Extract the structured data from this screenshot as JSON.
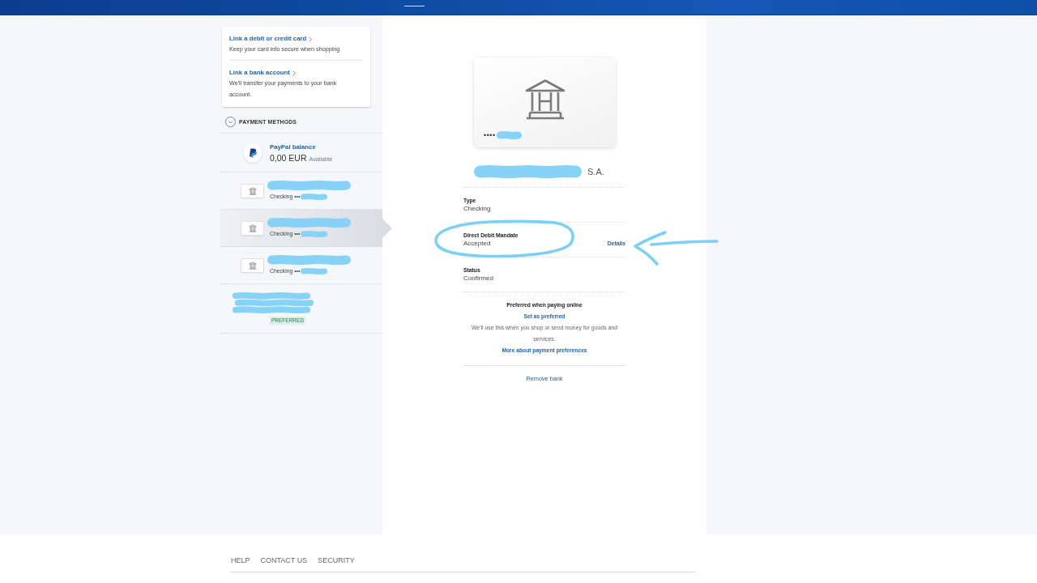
{
  "link_card": {
    "items": [
      {
        "title": "Link a debit or credit card",
        "text": "Keep your card info secure when shopping"
      },
      {
        "title": "Link a bank account",
        "text": "We'll transfer your payments to your bank account."
      }
    ]
  },
  "payment_methods": {
    "title": "PAYMENT METHODS",
    "items": [
      {
        "kind": "balance",
        "selected": false,
        "title": "PayPal balance",
        "amount": "0,00 EUR",
        "note": "Available"
      },
      {
        "kind": "bank",
        "selected": false,
        "detail": "Checking •••"
      },
      {
        "kind": "bank",
        "selected": true,
        "detail": "Checking •••"
      },
      {
        "kind": "bank",
        "selected": false,
        "detail": "Checking •••"
      },
      {
        "kind": "masked",
        "selected": false,
        "badge": "PREFERRED"
      }
    ]
  },
  "detail": {
    "card": {
      "mask": "••••"
    },
    "name_suffix": "S.A.",
    "fields": [
      {
        "label": "Type",
        "value": "Checking"
      },
      {
        "label": "Direct Debit Mandate",
        "value": "Accepted",
        "action": "Details"
      },
      {
        "label": "Status",
        "value": "Confirmed"
      }
    ],
    "preferred": {
      "title": "Preferred when paying online",
      "action": "Set as preferred",
      "text": "We'll use this when you shop or send money for goods and services.",
      "link": "More about payment preferences"
    },
    "remove": "Remove bank"
  },
  "footer": {
    "links": [
      "HELP",
      "CONTACT US",
      "SECURITY"
    ]
  }
}
